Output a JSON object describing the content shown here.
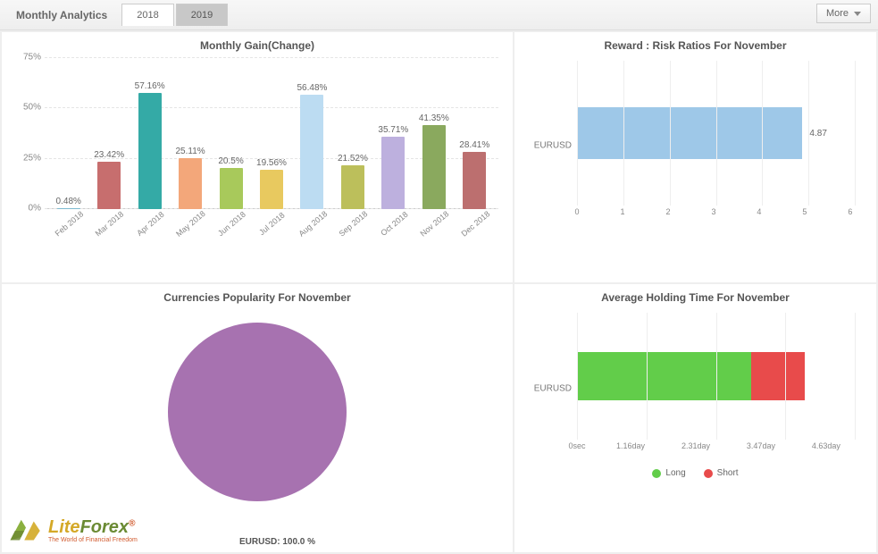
{
  "header": {
    "title": "Monthly Analytics",
    "tabs": [
      {
        "label": "2018",
        "active": true
      },
      {
        "label": "2019",
        "active": false
      }
    ],
    "more_label": "More"
  },
  "panels": {
    "monthly_gain": {
      "title": "Monthly Gain(Change)"
    },
    "reward_risk": {
      "title": "Reward : Risk Ratios For November",
      "ylabel": "EURUSD",
      "value_label": "4.87"
    },
    "currencies": {
      "title": "Currencies Popularity For November",
      "label": "EURUSD: 100.0 %"
    },
    "holding_time": {
      "title": "Average Holding Time For November",
      "ylabel": "EURUSD",
      "legend": {
        "long": "Long",
        "short": "Short"
      }
    }
  },
  "logo": {
    "brand_lite": "Lite",
    "brand_forex": "Forex",
    "tagline": "The World of Financial Freedom"
  },
  "chart_data": [
    {
      "id": "monthly_gain",
      "type": "bar",
      "title": "Monthly Gain(Change)",
      "ylabel": "",
      "ylim": [
        0,
        75
      ],
      "yticks": [
        0,
        25,
        50,
        75
      ],
      "categories": [
        "Feb 2018",
        "Mar 2018",
        "Apr 2018",
        "May 2018",
        "Jun 2018",
        "Jul 2018",
        "Aug 2018",
        "Sep 2018",
        "Oct 2018",
        "Nov 2018",
        "Dec 2018"
      ],
      "values": [
        0.48,
        23.42,
        57.16,
        25.11,
        20.5,
        19.56,
        56.48,
        21.52,
        35.71,
        41.35,
        28.41
      ],
      "value_labels": [
        "0.48%",
        "23.42%",
        "57.16%",
        "25.11%",
        "20.5%",
        "19.56%",
        "56.48%",
        "21.52%",
        "35.71%",
        "41.35%",
        "28.41%"
      ],
      "colors": [
        "#7dbad0",
        "#c76e6e",
        "#34aaa6",
        "#f3a77a",
        "#a8c95b",
        "#e8c95f",
        "#bcdcf2",
        "#bcbf5b",
        "#bdb0de",
        "#8aa95e",
        "#bc6f6f"
      ]
    },
    {
      "id": "reward_risk",
      "type": "bar_horizontal",
      "title": "Reward : Risk Ratios For November",
      "categories": [
        "EURUSD"
      ],
      "values": [
        4.87
      ],
      "xlim": [
        0,
        6
      ],
      "xticks": [
        0,
        1,
        2,
        3,
        4,
        5,
        6
      ],
      "color": "#9ec8e8"
    },
    {
      "id": "currencies",
      "type": "pie",
      "title": "Currencies Popularity For November",
      "series": [
        {
          "name": "EURUSD",
          "value": 100.0
        }
      ],
      "colors": [
        "#a772b0"
      ]
    },
    {
      "id": "holding_time",
      "type": "bar_horizontal_stacked",
      "title": "Average Holding Time For November",
      "categories": [
        "EURUSD"
      ],
      "xlim": [
        0,
        4.63
      ],
      "xticks": [
        "0sec",
        "1.16day",
        "2.31day",
        "3.47day",
        "4.63day"
      ],
      "series": [
        {
          "name": "Long",
          "values": [
            2.9
          ],
          "color": "#62cd4a"
        },
        {
          "name": "Short",
          "values": [
            0.9
          ],
          "color": "#e84b4b"
        }
      ]
    }
  ]
}
